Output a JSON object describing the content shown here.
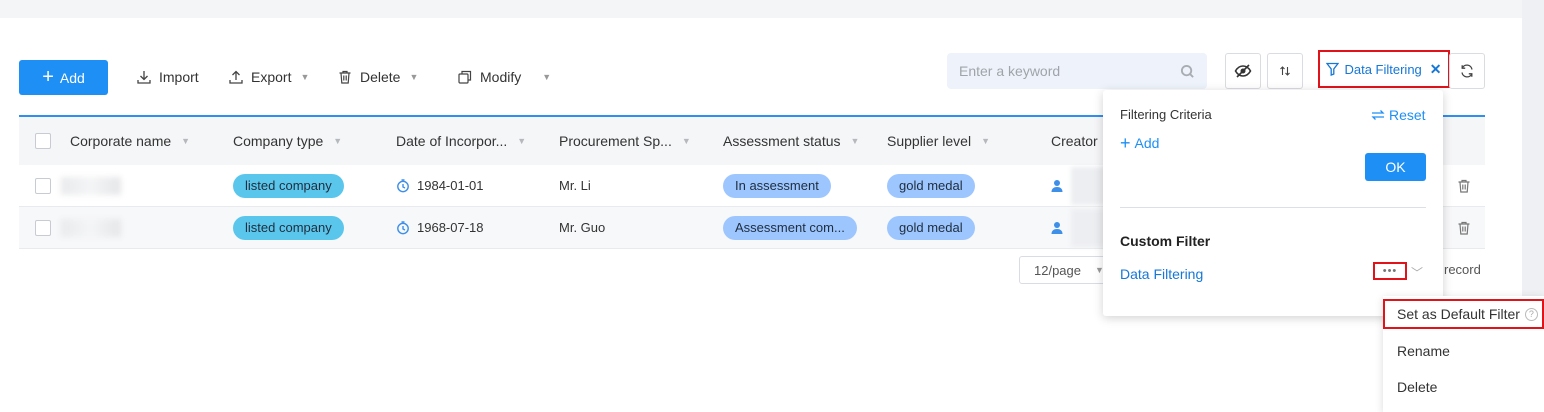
{
  "toolbar": {
    "add_label": "Add",
    "import_label": "Import",
    "export_label": "Export",
    "delete_label": "Delete",
    "modify_label": "Modify",
    "search_placeholder": "Enter a keyword",
    "data_filtering_label": "Data Filtering"
  },
  "table": {
    "columns": [
      "Corporate name",
      "Company type",
      "Date of Incorpor...",
      "Procurement Sp...",
      "Assessment status",
      "Supplier level",
      "Creator"
    ],
    "rows": [
      {
        "company_type": "listed company",
        "date": "1984-01-01",
        "procurement": "Mr. Li",
        "status": "In assessment",
        "level": "gold medal"
      },
      {
        "company_type": "listed company",
        "date": "1968-07-18",
        "procurement": "Mr. Guo",
        "status": "Assessment com...",
        "level": "gold medal"
      }
    ]
  },
  "pagination": {
    "page_size": "12/page",
    "record_text": "record"
  },
  "filter_popover": {
    "title": "Filtering Criteria",
    "reset_label": "Reset",
    "add_label": "Add",
    "ok_label": "OK",
    "custom_filter_heading": "Custom Filter",
    "custom_filter_item": "Data Filtering",
    "more_label": "•••"
  },
  "context_menu": {
    "items": [
      "Set as Default Filter",
      "Rename",
      "Delete"
    ]
  },
  "colors": {
    "accent": "#1e8ff5",
    "highlight_border": "#e0131b",
    "tag_company": "#5bc6ec",
    "tag_status": "#9dc6ff"
  }
}
